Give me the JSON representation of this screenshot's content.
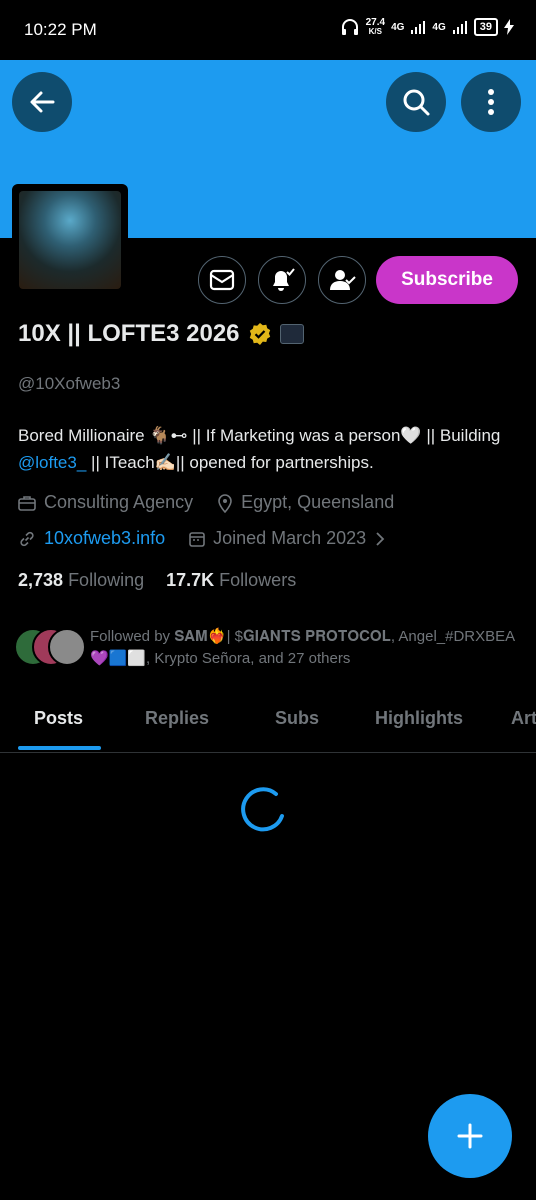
{
  "status_bar": {
    "time": "10:22 PM",
    "speed": "27.4",
    "speed_unit": "K/S",
    "net1": "4G",
    "net2": "4G",
    "battery": "39"
  },
  "profile": {
    "name": "10X || LOFTE3 2026",
    "handle": "@10Xofweb3",
    "bio_part1": "Bored Millionaire 🐐⊷ || If Marketing was a person🤍 || Building ",
    "bio_mention": "@lofte3_",
    "bio_part2": " || ITeach✍🏻|| opened for partnerships.",
    "category": "Consulting Agency",
    "location": "Egypt, Queensland",
    "website": "10xofweb3.info",
    "joined": "Joined March 2023",
    "following_count": "2,738",
    "following_label": "Following",
    "followers_count": "17.7K",
    "followers_label": "Followers",
    "followed_by": "Followed by 𝐒𝐀𝐌❤️‍🔥| $𝐆𝐈𝐀𝐍𝐓𝐒 𝐏𝐑𝐎𝐓𝐎𝐂𝐎𝐋, Angel_#DRXBEA 💜🟦⬜, Krypto Señora, and 27 others"
  },
  "actions": {
    "subscribe": "Subscribe"
  },
  "tabs": [
    "Posts",
    "Replies",
    "Subs",
    "Highlights",
    "Art"
  ],
  "icons": {
    "back": "arrow-left-icon",
    "search": "search-icon",
    "more": "more-vertical-icon",
    "message": "envelope-icon",
    "notify": "bell-check-icon",
    "follow": "person-check-icon",
    "compose": "plus-icon"
  },
  "colors": {
    "banner": "#1d9bf0",
    "subscribe": "#c936c9",
    "accent": "#1d9bf0",
    "verified": "#e2b719"
  }
}
